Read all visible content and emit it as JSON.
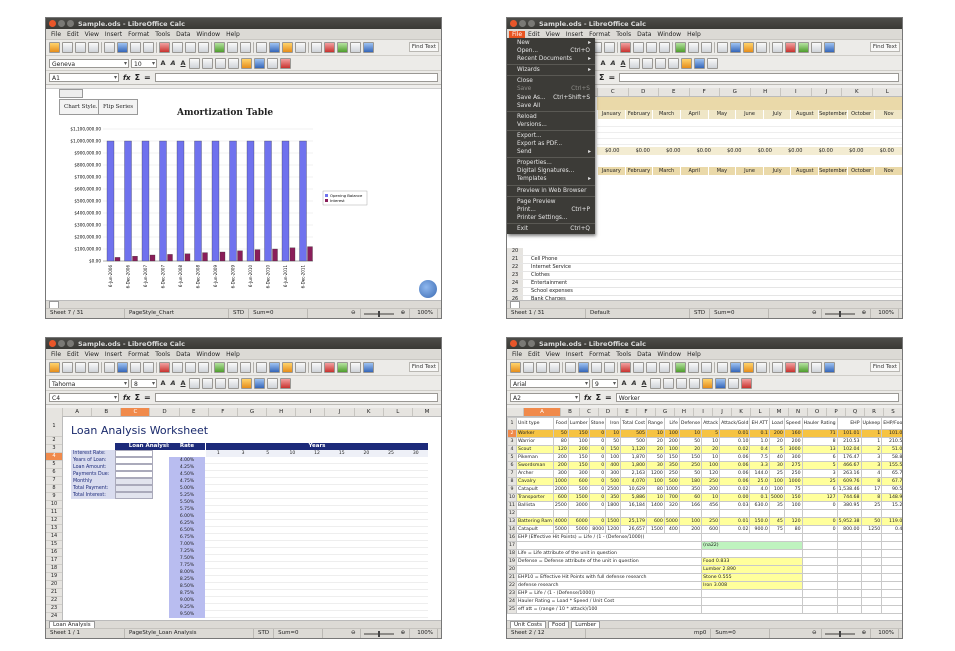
{
  "shared": {
    "menu": [
      "File",
      "Edit",
      "View",
      "Insert",
      "Format",
      "Tools",
      "Data",
      "Window",
      "Help"
    ],
    "find_text": "Find Text",
    "fx": "fx",
    "sigma": "Σ",
    "equals": "="
  },
  "win1": {
    "title": "Sample.ods - LibreOffice Calc",
    "font_name": "Geneva",
    "font_size": "10",
    "cell_ref": "A1",
    "buttons": [
      "Chart Style...",
      "Flip Series"
    ],
    "status": [
      "Sheet 7 / 31",
      "PageStyle_Chart",
      "STD",
      "Sum=0"
    ],
    "zoom": "100%",
    "chart_data": {
      "type": "bar",
      "title": "Amortization Table",
      "categories": [
        "6-Jun-2006",
        "6-Dec-2006",
        "6-Jun-2007",
        "6-Dec-2007",
        "6-Jun-2008",
        "6-Dec-2008",
        "6-Jun-2009",
        "6-Dec-2009",
        "6-Jun-2010",
        "6-Dec-2010",
        "6-Jun-2011",
        "6-Dec-2011"
      ],
      "series": [
        {
          "name": "Opening Balance",
          "values": [
            1000000,
            1000000,
            1000000,
            1000000,
            1000000,
            1000000,
            1000000,
            1000000,
            1000000,
            1000000,
            1000000,
            1000000
          ]
        },
        {
          "name": "Interest",
          "values": [
            30000,
            40000,
            50000,
            55000,
            60000,
            70000,
            75000,
            85000,
            95000,
            100000,
            110000,
            120000
          ]
        }
      ],
      "ylim": [
        0,
        1100000
      ],
      "yticks": [
        "$1,100,000.00",
        "$1,000,000.00",
        "$900,000.00",
        "$800,000.00",
        "$700,000.00",
        "$600,000.00",
        "$500,000.00",
        "$400,000.00",
        "$300,000.00",
        "$200,000.00",
        "$100,000.00",
        "$0.00"
      ],
      "legend": "right",
      "colors": [
        "#6f72ee",
        "#8a1e5a"
      ]
    }
  },
  "win2": {
    "title": "Sample.ods - LibreOffice Calc",
    "months": [
      "January",
      "February",
      "March",
      "April",
      "May",
      "June",
      "July",
      "August",
      "September",
      "October",
      "Nov"
    ],
    "cols": [
      "C",
      "D",
      "E",
      "F",
      "G",
      "H",
      "I",
      "J",
      "K",
      "L"
    ],
    "menu_items": [
      {
        "label": "New",
        "shortcut": "",
        "arrow": true,
        "dis": false
      },
      {
        "label": "Open...",
        "shortcut": "Ctrl+O",
        "arrow": false,
        "dis": false
      },
      {
        "label": "Recent Documents",
        "shortcut": "",
        "arrow": true,
        "dis": false
      },
      {
        "sep": true
      },
      {
        "label": "Wizards",
        "shortcut": "",
        "arrow": true,
        "dis": false
      },
      {
        "sep": true
      },
      {
        "label": "Close",
        "shortcut": "",
        "arrow": false,
        "dis": false
      },
      {
        "label": "Save",
        "shortcut": "Ctrl+S",
        "arrow": false,
        "dis": true
      },
      {
        "label": "Save As...",
        "shortcut": "Ctrl+Shift+S",
        "arrow": false,
        "dis": false
      },
      {
        "label": "Save All",
        "shortcut": "",
        "arrow": false,
        "dis": false
      },
      {
        "sep": true
      },
      {
        "label": "Reload",
        "shortcut": "",
        "arrow": false,
        "dis": false
      },
      {
        "label": "Versions...",
        "shortcut": "",
        "arrow": false,
        "dis": false
      },
      {
        "sep": true
      },
      {
        "label": "Export...",
        "shortcut": "",
        "arrow": false,
        "dis": false
      },
      {
        "label": "Export as PDF...",
        "shortcut": "",
        "arrow": false,
        "dis": false
      },
      {
        "label": "Send",
        "shortcut": "",
        "arrow": true,
        "dis": false
      },
      {
        "sep": true
      },
      {
        "label": "Properties...",
        "shortcut": "",
        "arrow": false,
        "dis": false
      },
      {
        "label": "Digital Signatures...",
        "shortcut": "",
        "arrow": false,
        "dis": false
      },
      {
        "label": "Templates",
        "shortcut": "",
        "arrow": true,
        "dis": false
      },
      {
        "sep": true
      },
      {
        "label": "Preview in Web Browser",
        "shortcut": "",
        "arrow": false,
        "dis": false
      },
      {
        "sep": true
      },
      {
        "label": "Page Preview",
        "shortcut": "",
        "arrow": false,
        "dis": false
      },
      {
        "label": "Print...",
        "shortcut": "Ctrl+P",
        "arrow": false,
        "dis": false
      },
      {
        "label": "Printer Settings...",
        "shortcut": "",
        "arrow": false,
        "dis": false
      },
      {
        "sep": true
      },
      {
        "label": "Exit",
        "shortcut": "Ctrl+Q",
        "arrow": false,
        "dis": false
      }
    ],
    "expense_rows": [
      {
        "n": "20",
        "label": ""
      },
      {
        "n": "21",
        "label": "Cell Phone"
      },
      {
        "n": "22",
        "label": "Internet Service"
      },
      {
        "n": "23",
        "label": "Clothes"
      },
      {
        "n": "24",
        "label": "Entertainment"
      },
      {
        "n": "25",
        "label": "School expenses"
      },
      {
        "n": "26",
        "label": "Bank Charges"
      },
      {
        "n": "27",
        "label": "Misc."
      },
      {
        "n": "28",
        "label": "Total Expenses"
      }
    ],
    "zero": "$0.00",
    "status": [
      "Sheet 1 / 31",
      "Default",
      "STD",
      "Sum=0"
    ],
    "zoom": "100%"
  },
  "win3": {
    "title": "Sample.ods - LibreOffice Calc",
    "font_name": "Tahoma",
    "font_size": "8",
    "cell_ref": "C4",
    "heading": "Loan Analysis Worksheet",
    "panel_title": "Loan Analysis",
    "fields": [
      "Interest Rate:",
      "Years of Loan:",
      "Loan Amount:",
      "Payments Due:",
      "Monthly Payment:",
      "Total Payment:",
      "Total Interest:"
    ],
    "rate_header": "Rate",
    "years_header": "Years",
    "years": [
      "1",
      "3",
      "5",
      "10",
      "12",
      "15",
      "20",
      "25",
      "30"
    ],
    "rates": [
      "4.00%",
      "4.25%",
      "4.50%",
      "4.75%",
      "5.00%",
      "5.25%",
      "5.50%",
      "5.75%",
      "6.00%",
      "6.25%",
      "6.50%",
      "6.75%",
      "7.00%",
      "7.25%",
      "7.50%",
      "7.75%",
      "8.00%",
      "8.25%",
      "8.50%",
      "8.75%",
      "9.00%",
      "9.25%",
      "9.50%"
    ],
    "cols": [
      "A",
      "B",
      "C",
      "D",
      "E",
      "F",
      "G",
      "H",
      "I",
      "J",
      "K",
      "L",
      "M"
    ],
    "tab": "Loan Analysis",
    "status": [
      "Sheet 1 / 1",
      "PageStyle_Loan Analysis",
      "STD",
      "Sum=0"
    ],
    "zoom": "100%"
  },
  "win4": {
    "title": "Sample.ods - LibreOffice Calc",
    "font_name": "Arial",
    "font_size": "9",
    "cell_ref": "A2",
    "input": "Worker",
    "cols": [
      "A",
      "B",
      "C",
      "D",
      "E",
      "F",
      "G",
      "H",
      "I",
      "J",
      "K",
      "L",
      "M",
      "N",
      "O",
      "P",
      "Q",
      "R",
      "S"
    ],
    "header_row": [
      "Unit type",
      "Food",
      "Lumber",
      "Stone",
      "Iron",
      "Total Cost",
      "Range",
      "Life",
      "Defense",
      "Attack",
      "Attack/Gold",
      "EH ATT",
      "Load",
      "Speed",
      "Hauler Rating",
      "EHP",
      "Upkeep",
      "EHP/Food",
      "Build (minutes)"
    ],
    "units": [
      [
        "Worker",
        "50",
        "150",
        "0",
        "10",
        "505",
        "10",
        "100",
        "10",
        "5",
        "0.01",
        "0.1",
        "200",
        "160",
        "71",
        "101.01",
        "1",
        "101.01",
        "0.8"
      ],
      [
        "Warrior",
        "80",
        "100",
        "0",
        "50",
        "500",
        "20",
        "200",
        "50",
        "10",
        "0.10",
        "1.0",
        "20",
        "200",
        "8",
        "210.53",
        "1",
        "210.53",
        "0.4"
      ],
      [
        "Scout",
        "120",
        "200",
        "0",
        "150",
        "1,120",
        "20",
        "100",
        "20",
        "20",
        "0.02",
        "0.4",
        "5",
        "3000",
        "13",
        "102.04",
        "2",
        "51.02",
        "1.6"
      ],
      [
        "Pikeman",
        "200",
        "150",
        "0",
        "100",
        "1,870",
        "50",
        "150",
        "150",
        "10",
        "0.06",
        "7.5",
        "40",
        "300",
        "6",
        "176.47",
        "3",
        "58.82",
        "2.5"
      ],
      [
        "Swordsman",
        "200",
        "150",
        "0",
        "400",
        "1,800",
        "30",
        "350",
        "250",
        "100",
        "0.06",
        "3.3",
        "30",
        "275",
        "5",
        "466.67",
        "3",
        "155.56",
        "3.3"
      ],
      [
        "Archer",
        "300",
        "300",
        "0",
        "300",
        "2,163",
        "1200",
        "250",
        "50",
        "120",
        "0.06",
        "144.0",
        "25",
        "250",
        "3",
        "263.16",
        "4",
        "65.79",
        "5.8"
      ],
      [
        "Cavalry",
        "1000",
        "600",
        "0",
        "500",
        "4,070",
        "100",
        "500",
        "180",
        "250",
        "0.06",
        "25.0",
        "100",
        "1000",
        "25",
        "609.76",
        "8",
        "67.75",
        "8.5"
      ],
      [
        "Catapult",
        "2000",
        "500",
        "0",
        "2500",
        "10,629",
        "80",
        "1000",
        "350",
        "200",
        "0.02",
        "4.0",
        "100",
        "75",
        "6",
        "1,538.46",
        "17",
        "90.50",
        "25.0"
      ],
      [
        "Transporter",
        "600",
        "1500",
        "0",
        "350",
        "5,886",
        "10",
        "700",
        "60",
        "10",
        "0.00",
        "0.1",
        "5000",
        "150",
        "127",
        "744.68",
        "8",
        "148.94",
        "16.0"
      ],
      [
        "Ballista",
        "2500",
        "3000",
        "0",
        "1800",
        "16,184",
        "1400",
        "320",
        "166",
        "456",
        "0.03",
        "630.0",
        "35",
        "100",
        "0",
        "380.95",
        "25",
        "15.24",
        "50.0"
      ],
      [
        "",
        "",
        "",
        "",
        "",
        "",
        "",
        "",
        "",
        "",
        "",
        "",
        "",
        "",
        "",
        "",
        "",
        "",
        ""
      ],
      [
        "Battering Ram",
        "4000",
        "6000",
        "0",
        "1500",
        "25,179",
        "600",
        "5000",
        "100",
        "250",
        "0.01",
        "150.0",
        "45",
        "120",
        "0",
        "5,952.38",
        "50",
        "119.05",
        "75.0"
      ],
      [
        "Catapult",
        "5000",
        "5000",
        "8000",
        "1200",
        "26,657",
        "1500",
        "400",
        "200",
        "600",
        "0.02",
        "900.0",
        "75",
        "80",
        "0",
        "800.00",
        "1250",
        "0.48",
        "100.0"
      ]
    ],
    "notes": [
      {
        "r": "16",
        "text": "EHP (Effective Hit Points) = Life / (1 - (Defense/1000))"
      },
      {
        "r": "17",
        "text": ""
      },
      {
        "r": "18",
        "text": "Life = Life attribute of the unit in question"
      },
      {
        "r": "19",
        "text": "Defense = Defense attribute of the unit in question"
      },
      {
        "r": "20",
        "text": ""
      },
      {
        "r": "21",
        "text": "EHP10 = Effective Hit Points with full defense research"
      },
      {
        "r": "22",
        "text": "defense research"
      },
      {
        "r": "23",
        "text": "EHP = Life / (1 - (Defense/1000))"
      },
      {
        "r": "24",
        "text": "Hauler Rating = Load * Speed / Unit Cost"
      },
      {
        "r": "25",
        "text": "eff att = (range / 10 * attack)/100"
      }
    ],
    "formula_cell": "(na22)",
    "lookup": [
      [
        "Food",
        "0.833"
      ],
      [
        "Lumber",
        "2.890"
      ],
      [
        "Stone",
        "0.555"
      ],
      [
        "Iron",
        "3.008"
      ]
    ],
    "tabs": [
      "Unit Costs",
      "Food",
      "Lumber"
    ],
    "status": [
      "Sheet 2 / 12",
      "",
      "mp0",
      "Sum=0"
    ],
    "zoom": "100%"
  }
}
